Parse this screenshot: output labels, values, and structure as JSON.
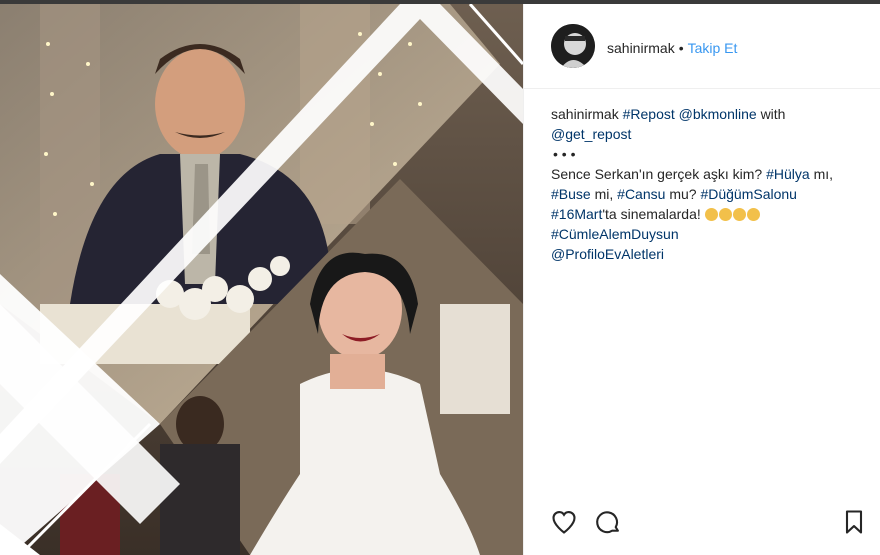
{
  "post": {
    "username": "sahinirmak",
    "separator": "•",
    "follow_label": "Takip Et"
  },
  "caption": {
    "line1_user": "sahinirmak",
    "line1_tag1": "#Repost",
    "line1_mention": "@bkmonline",
    "line1_rest": "with",
    "line2_mention": "@get_repost",
    "dots": "•   •   •",
    "line4_text": "Sence Serkan'ın gerçek aşkı kim?",
    "line4_tag": "#Hülya",
    "line4_end": "mı,",
    "line5_tag1": "#Buse",
    "line5_mid1": "mi,",
    "line5_tag2": "#Cansu",
    "line5_mid2": "mu?",
    "line5_tag3": "#DüğümSalonu",
    "line6_tag": "#16Mart",
    "line6_rest": "'ta sinemalarda!",
    "line7_tag": "#CümleAlemDuysun",
    "line8_mention": "@ProfiloEvAletleri"
  },
  "icons": {
    "like": "heart-icon",
    "comment": "comment-icon",
    "save": "bookmark-icon"
  },
  "colors": {
    "link": "#003569",
    "follow": "#3897f0",
    "text": "#262626"
  }
}
